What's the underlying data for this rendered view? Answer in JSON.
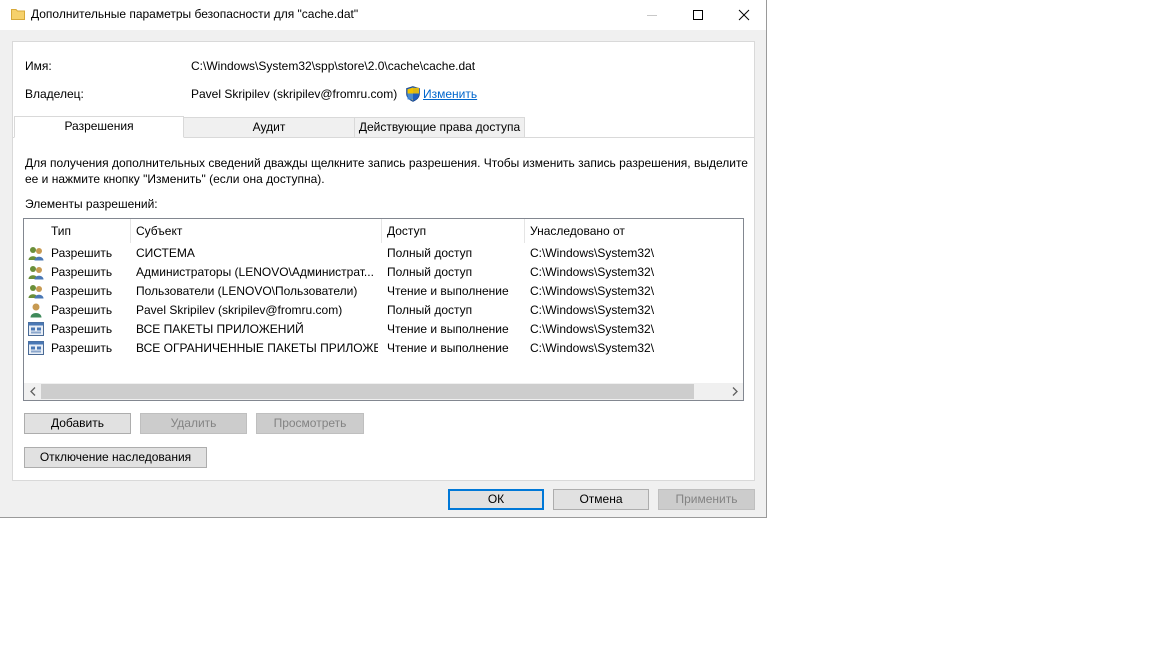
{
  "window": {
    "title": "Дополнительные параметры безопасности  для \"cache.dat\""
  },
  "owner_info": {
    "name_label": "Имя:",
    "name_value": "C:\\Windows\\System32\\spp\\store\\2.0\\cache\\cache.dat",
    "owner_label": "Владелец:",
    "owner_value": "Pavel Skripilev (skripilev@fromru.com)",
    "change_link": "Изменить"
  },
  "tabs": [
    {
      "label": "Разрешения",
      "active": true
    },
    {
      "label": "Аудит",
      "active": false
    },
    {
      "label": "Действующие права доступа",
      "active": false
    }
  ],
  "description": "Для получения дополнительных сведений дважды щелкните запись разрешения. Чтобы изменить запись разрешения, выделите ее и нажмите кнопку \"Изменить\" (если она доступна).",
  "permissions": {
    "label": "Элементы разрешений:",
    "columns": [
      "Тип",
      "Субъект",
      "Доступ",
      "Унаследовано от"
    ],
    "rows": [
      {
        "icon": "users-icon",
        "type": "Разрешить",
        "subject": "СИСТЕМА",
        "access": "Полный доступ",
        "inherited": "C:\\Windows\\System32\\"
      },
      {
        "icon": "users-icon",
        "type": "Разрешить",
        "subject": "Администраторы (LENOVO\\Администрат...",
        "access": "Полный доступ",
        "inherited": "C:\\Windows\\System32\\"
      },
      {
        "icon": "users-icon",
        "type": "Разрешить",
        "subject": "Пользователи (LENOVO\\Пользователи)",
        "access": "Чтение и выполнение",
        "inherited": "C:\\Windows\\System32\\"
      },
      {
        "icon": "user-icon",
        "type": "Разрешить",
        "subject": "Pavel Skripilev (skripilev@fromru.com)",
        "access": "Полный доступ",
        "inherited": "C:\\Windows\\System32\\"
      },
      {
        "icon": "app-package-icon",
        "type": "Разрешить",
        "subject": "ВСЕ ПАКЕТЫ ПРИЛОЖЕНИЙ",
        "access": "Чтение и выполнение",
        "inherited": "C:\\Windows\\System32\\"
      },
      {
        "icon": "app-package-icon",
        "type": "Разрешить",
        "subject": "ВСЕ ОГРАНИЧЕННЫЕ ПАКЕТЫ ПРИЛОЖЕ...",
        "access": "Чтение и выполнение",
        "inherited": "C:\\Windows\\System32\\"
      }
    ]
  },
  "buttons": {
    "add": "Добавить",
    "remove": "Удалить",
    "view": "Просмотреть",
    "disable_inheritance": "Отключение наследования",
    "ok": "ОК",
    "cancel": "Отмена",
    "apply": "Применить"
  },
  "colors": {
    "accent": "#0078d7",
    "link": "#0066cc"
  }
}
